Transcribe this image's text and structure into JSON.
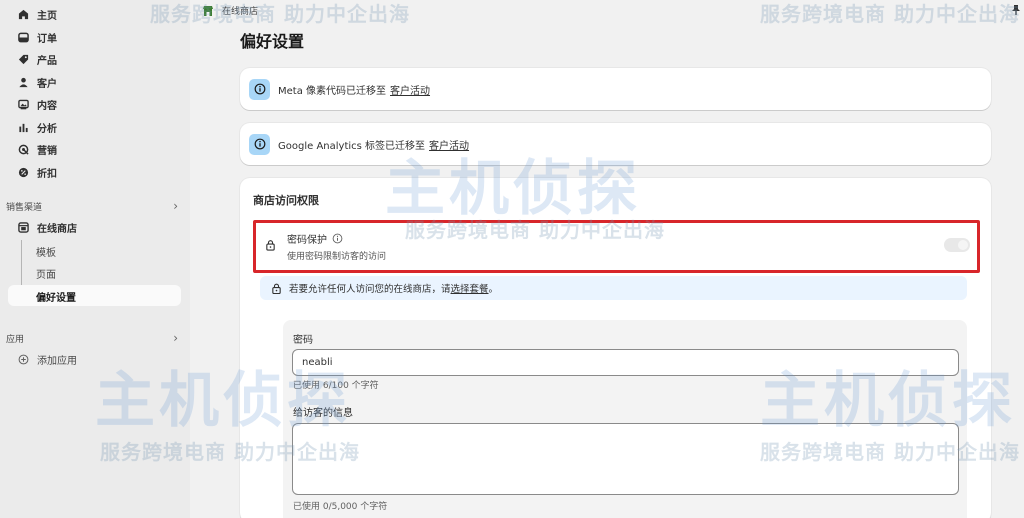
{
  "sidebar": {
    "items": [
      {
        "label": "主页",
        "icon": "home-icon"
      },
      {
        "label": "订单",
        "icon": "inbox-icon"
      },
      {
        "label": "产品",
        "icon": "tag-icon"
      },
      {
        "label": "客户",
        "icon": "person-icon"
      },
      {
        "label": "内容",
        "icon": "image-icon"
      },
      {
        "label": "分析",
        "icon": "bar-chart-icon"
      },
      {
        "label": "营销",
        "icon": "target-icon"
      },
      {
        "label": "折扣",
        "icon": "discount-icon"
      }
    ],
    "sales_channels_header": "销售渠道",
    "online_store": "在线商店",
    "sub_items": [
      "模板",
      "页面",
      "偏好设置"
    ],
    "apps_header": "应用",
    "add_app": "添加应用"
  },
  "breadcrumb": {
    "store": "在线商店"
  },
  "page": {
    "title": "偏好设置"
  },
  "notices": [
    {
      "text": "Meta 像素代码已迁移至",
      "link": "客户活动"
    },
    {
      "text": "Google Analytics 标签已迁移至",
      "link": "客户活动"
    }
  ],
  "access": {
    "title": "商店访问权限",
    "password_protection_label": "密码保护",
    "password_protection_desc": "使用密码限制访客的访问",
    "info_prefix": "若要允许任何人访问您的在线商店，请",
    "info_link": "选择套餐",
    "info_suffix": "。",
    "password_label": "密码",
    "password_value": "neabli",
    "password_count": "已使用 6/100 个字符",
    "message_label": "给访客的信息",
    "message_value": "",
    "message_count": "已使用 0/5,000 个字符"
  },
  "watermark": {
    "text": "服务跨境电商  助力中企出海",
    "brand": "主机侦探"
  },
  "colors": {
    "highlight": "#d8262a",
    "info_badge": "#a8d6f7",
    "info_strip": "#eaf4ff"
  }
}
